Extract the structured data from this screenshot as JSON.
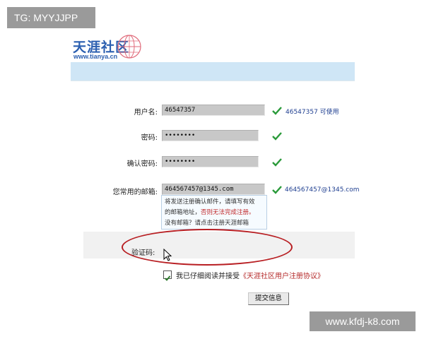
{
  "watermarks": {
    "top_left": "TG: MYYJJPP",
    "bottom_right": "www.kfdj-k8.com"
  },
  "logo": {
    "title": "天涯社区",
    "url": "www.tianya.cn"
  },
  "form": {
    "username": {
      "label": "用户名:",
      "value": "46547357",
      "status": "46547357 可使用"
    },
    "password": {
      "label": "密码:",
      "value": "••••••••"
    },
    "confirm_password": {
      "label": "确认密码:",
      "value": "••••••••"
    },
    "email": {
      "label": "您常用的邮箱:",
      "value": "464567457@1345.com",
      "status": "464567457@1345.com"
    },
    "email_tip": {
      "line1": "将发送注册确认邮件，请填写有效",
      "line2_a": "的邮箱地址，",
      "line2_b": "否则无法完成注册。",
      "line3": "没有邮箱？请点击注册天涯邮箱"
    },
    "captcha": {
      "label": "验证码:"
    },
    "agreement": {
      "text": "我已仔细阅读并接受",
      "link": "《天涯社区用户注册协议》",
      "checked": true
    },
    "submit_label": "提交信息"
  },
  "colors": {
    "brand": "#2b5fb0",
    "banner": "#cfe6f6",
    "highlight_ellipse": "#b81e22",
    "check": "#2a9a3a"
  },
  "icons": [
    "globe-logo-icon",
    "check-icon",
    "cursor-icon"
  ]
}
